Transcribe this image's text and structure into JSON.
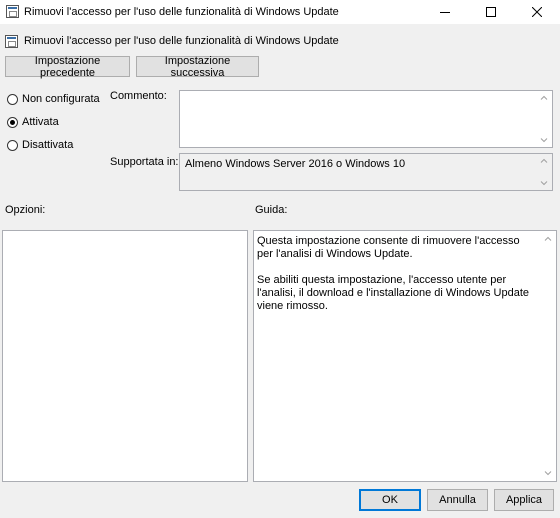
{
  "window": {
    "title": "Rimuovi l'accesso per l'uso delle funzionalità di Windows Update"
  },
  "header": {
    "policy_title": "Rimuovi l'accesso per l'uso delle funzionalità di Windows Update"
  },
  "nav": {
    "previous_label": "Impostazione precedente",
    "next_label": "Impostazione successiva"
  },
  "state": {
    "options": [
      {
        "label": "Non configurata",
        "checked": false
      },
      {
        "label": "Attivata",
        "checked": true
      },
      {
        "label": "Disattivata",
        "checked": false
      }
    ]
  },
  "comment": {
    "label": "Commento:",
    "value": ""
  },
  "supported": {
    "label": "Supportata in:",
    "value": "Almeno Windows Server 2016 o Windows 10"
  },
  "options_panel": {
    "label": "Opzioni:"
  },
  "help_panel": {
    "label": "Guida:",
    "paragraphs": [
      "Questa impostazione consente di rimuovere l'accesso per l'analisi di Windows Update.",
      "Se abiliti questa impostazione, l'accesso utente per l'analisi, il download e l'installazione di Windows Update viene rimosso."
    ]
  },
  "footer": {
    "ok_label": "OK",
    "cancel_label": "Annulla",
    "apply_label": "Applica"
  }
}
